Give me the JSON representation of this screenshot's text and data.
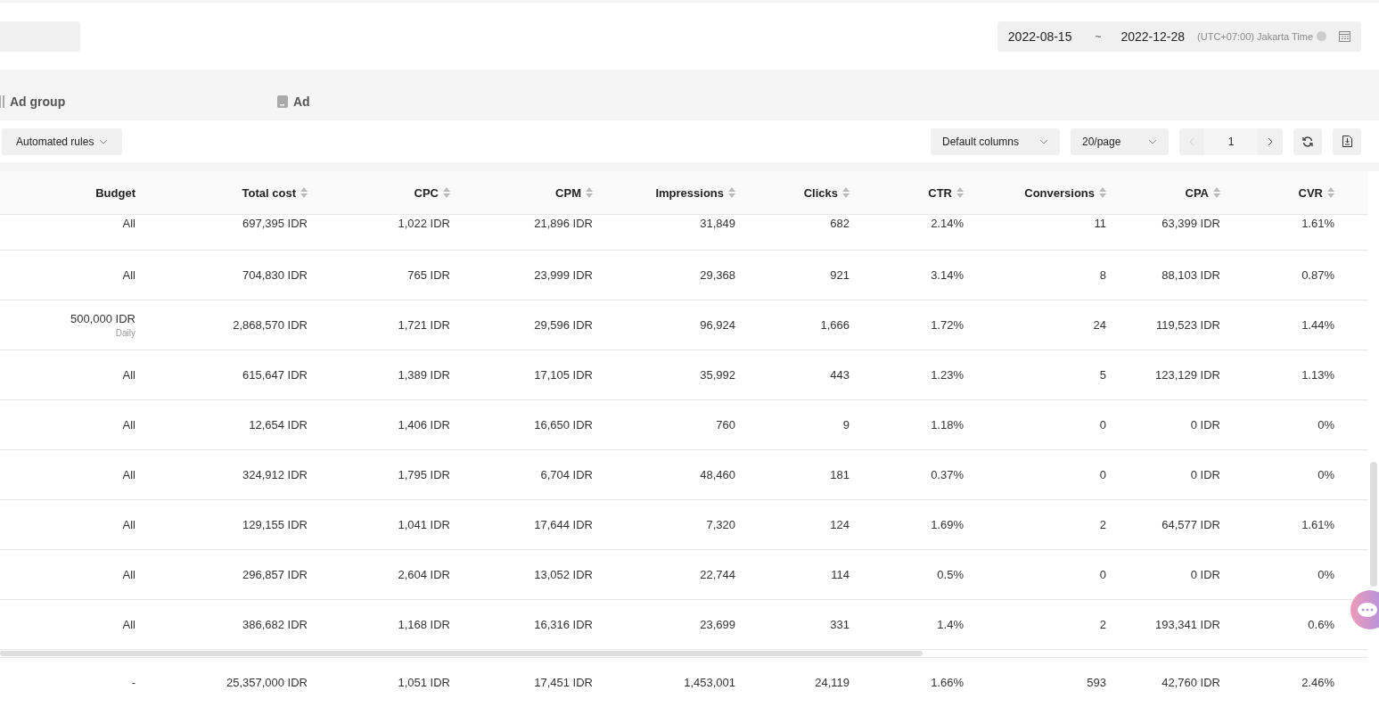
{
  "date_range": {
    "start": "2022-08-15",
    "separator": "~",
    "end": "2022-12-28",
    "timezone": "(UTC+07:00) Jakarta Time"
  },
  "tabs": [
    {
      "label": "Ad group",
      "kind": "columns"
    },
    {
      "label": "Ad",
      "kind": "card"
    }
  ],
  "toolbar": {
    "rules_button": "Automated rules",
    "columns_select": "Default columns",
    "page_size_select": "20/page",
    "pagination": {
      "page": "1",
      "prev_disabled": true,
      "next_disabled": false
    }
  },
  "table": {
    "columns": [
      "Budget",
      "Total cost",
      "CPC",
      "CPM",
      "Impressions",
      "Clicks",
      "CTR",
      "Conversions",
      "CPA",
      "CVR"
    ],
    "rows": [
      {
        "partial": true,
        "cells": [
          "All",
          "697,395 IDR",
          "1,022 IDR",
          "21,896 IDR",
          "31,849",
          "682",
          "2.14%",
          "11",
          "63,399 IDR",
          "1.61%"
        ]
      },
      {
        "cells": [
          "All",
          "704,830 IDR",
          "765 IDR",
          "23,999 IDR",
          "29,368",
          "921",
          "3.14%",
          "8",
          "88,103 IDR",
          "0.87%"
        ]
      },
      {
        "cells": [
          "500,000 IDR",
          "2,868,570 IDR",
          "1,721 IDR",
          "29,596 IDR",
          "96,924",
          "1,666",
          "1.72%",
          "24",
          "119,523 IDR",
          "1.44%"
        ],
        "budget_note": "Daily"
      },
      {
        "cells": [
          "All",
          "615,647 IDR",
          "1,389 IDR",
          "17,105 IDR",
          "35,992",
          "443",
          "1.23%",
          "5",
          "123,129 IDR",
          "1.13%"
        ]
      },
      {
        "cells": [
          "All",
          "12,654 IDR",
          "1,406 IDR",
          "16,650 IDR",
          "760",
          "9",
          "1.18%",
          "0",
          "0 IDR",
          "0%"
        ]
      },
      {
        "cells": [
          "All",
          "324,912 IDR",
          "1,795 IDR",
          "6,704 IDR",
          "48,460",
          "181",
          "0.37%",
          "0",
          "0 IDR",
          "0%"
        ]
      },
      {
        "cells": [
          "All",
          "129,155 IDR",
          "1,041 IDR",
          "17,644 IDR",
          "7,320",
          "124",
          "1.69%",
          "2",
          "64,577 IDR",
          "1.61%"
        ]
      },
      {
        "cells": [
          "All",
          "296,857 IDR",
          "2,604 IDR",
          "13,052 IDR",
          "22,744",
          "114",
          "0.5%",
          "0",
          "0 IDR",
          "0%"
        ]
      },
      {
        "cells": [
          "All",
          "386,682 IDR",
          "1,168 IDR",
          "16,316 IDR",
          "23,699",
          "331",
          "1.4%",
          "2",
          "193,341 IDR",
          "0.6%"
        ]
      }
    ],
    "total_row": [
      "-",
      "25,357,000 IDR",
      "1,051 IDR",
      "17,451 IDR",
      "1,453,001",
      "24,119",
      "1.66%",
      "593",
      "42,760 IDR",
      "2.46%"
    ]
  }
}
